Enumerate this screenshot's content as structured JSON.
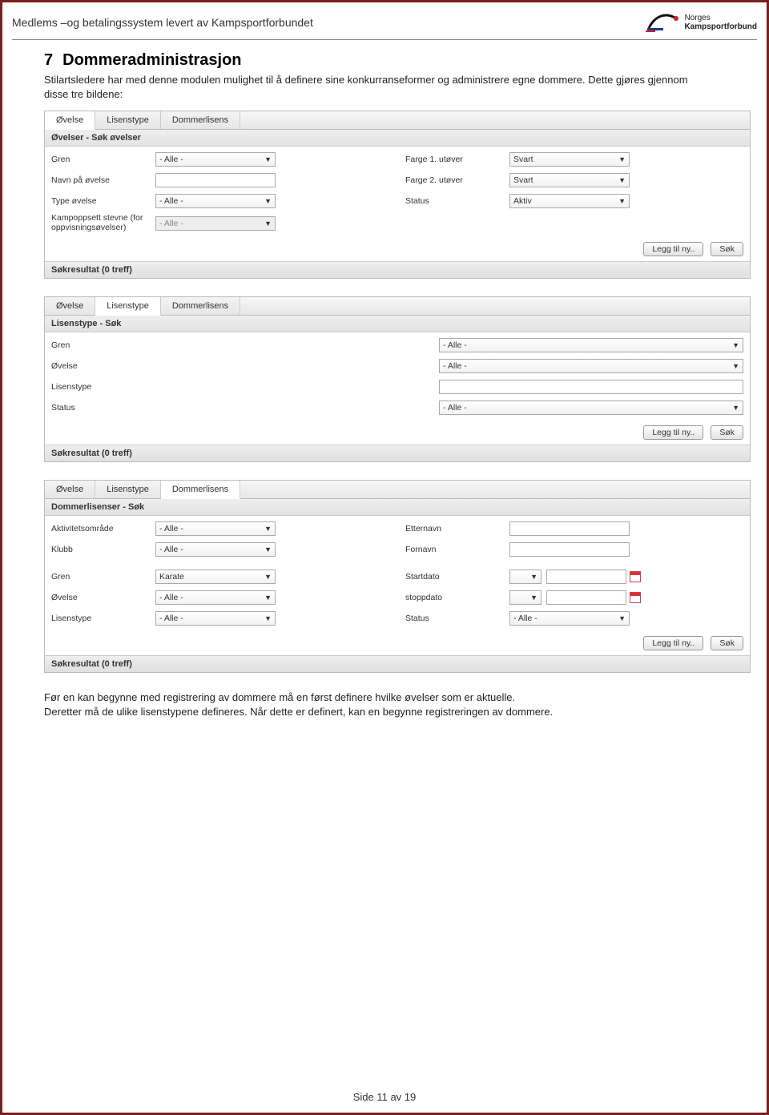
{
  "header": {
    "title": "Medlems –og betalingssystem levert av Kampsportforbundet",
    "logo": {
      "line1": "Norges",
      "line2": "Kampsportforbund"
    }
  },
  "section": {
    "number": "7",
    "title": "Dommeradministrasjon",
    "intro": "Stilartsledere har med denne modulen mulighet til å definere sine konkurranseformer og administrere egne dommere. Dette gjøres gjennom disse tre bildene:"
  },
  "common": {
    "tabs": {
      "ovelse": "Øvelse",
      "lisenstype": "Lisenstype",
      "dommerlisens": "Dommerlisens"
    },
    "btn_add": "Legg til ny..",
    "btn_search": "Søk",
    "opt_all": "- Alle -",
    "opt_svart": "Svart",
    "opt_aktiv": "Aktiv",
    "opt_karate": "Karate"
  },
  "panel1": {
    "subheader": "Øvelser - Søk øvelser",
    "labels": {
      "gren": "Gren",
      "navn": "Navn på øvelse",
      "type": "Type øvelse",
      "kampoppsett": "Kampoppsett stevne (for oppvisningsøvelser)",
      "farge1": "Farge 1. utøver",
      "farge2": "Farge 2. utøver",
      "status": "Status"
    },
    "result": "Søkresultat (0 treff)"
  },
  "panel2": {
    "subheader": "Lisenstype - Søk",
    "labels": {
      "gren": "Gren",
      "ovelse": "Øvelse",
      "lisenstype": "Lisenstype",
      "status": "Status"
    },
    "result": "Søkresultat (0 treff)"
  },
  "panel3": {
    "subheader": "Dommerlisenser - Søk",
    "labels": {
      "aktivitet": "Aktivitetsområde",
      "klubb": "Klubb",
      "gren": "Gren",
      "ovelse": "Øvelse",
      "lisenstype": "Lisenstype",
      "etternavn": "Etternavn",
      "fornavn": "Fornavn",
      "startdato": "Startdato",
      "stoppdato": "stoppdato",
      "status": "Status"
    },
    "result": "Søkresultat (0 treff)"
  },
  "outro": "Før en kan begynne med registrering av dommere må en først definere hvilke øvelser som er aktuelle.\nDeretter må de ulike lisenstypene defineres. Når dette er definert, kan en begynne registreringen av dommere.",
  "footer": "Side 11 av 19"
}
